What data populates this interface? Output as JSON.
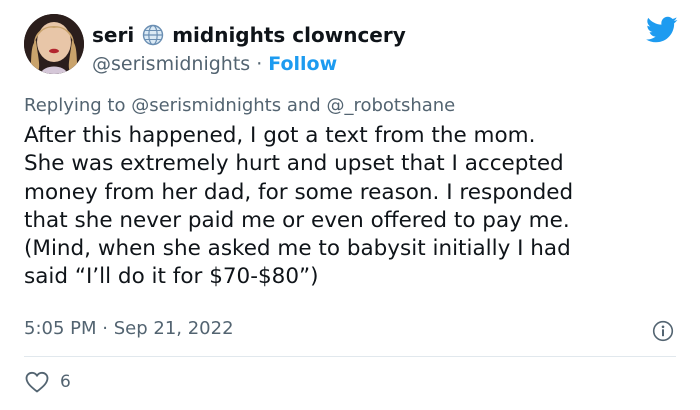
{
  "user": {
    "display_name": "seri",
    "display_name_suffix": "midnights clowncery",
    "handle": "@serismidnights",
    "separator": "·",
    "follow_label": "Follow"
  },
  "reply": {
    "prefix": "Replying to",
    "mention_1": "@serismidnights",
    "conjunction": "and",
    "mention_2": "@_robotshane"
  },
  "tweet": {
    "lines": [
      "After this happened, I got a text from the mom.",
      "She was extremely hurt and upset that I accepted",
      "money from her dad, for some reason. I responded",
      "that she never paid me or even offered to pay me.",
      "(Mind, when she asked me to babysit initially I had",
      "said “I’ll do it for $70-$80”)"
    ]
  },
  "meta": {
    "time": "5:05 PM",
    "separator": "·",
    "date": "Sep 21, 2022"
  },
  "engagement": {
    "likes": "6"
  },
  "icons": {
    "globe": "globe-icon",
    "twitter": "twitter-bird-icon",
    "info": "info-icon",
    "heart": "heart-icon"
  },
  "colors": {
    "accent": "#1d9bf0",
    "text": "#0f1419",
    "secondary": "#536471",
    "divider": "#e1e8ed"
  }
}
